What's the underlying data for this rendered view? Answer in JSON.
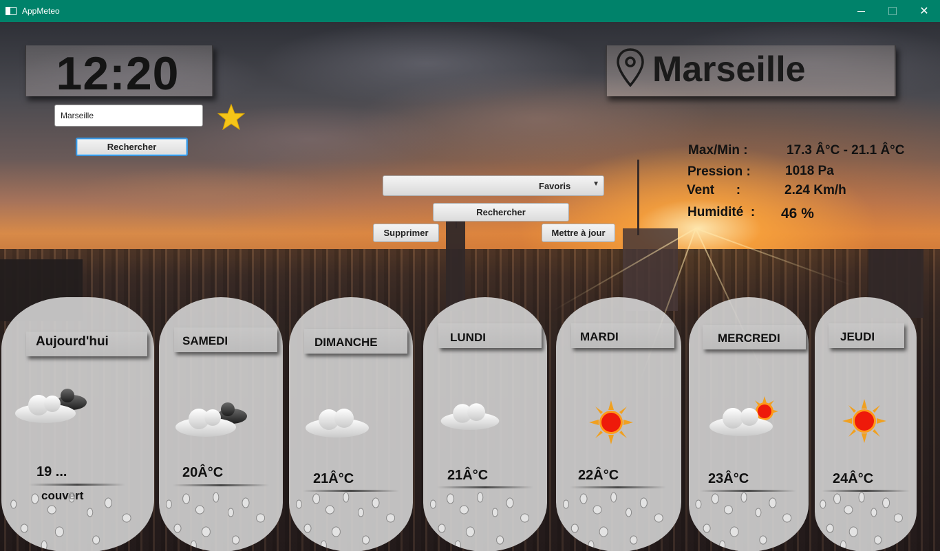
{
  "window": {
    "title": "AppMeteo",
    "controls": {
      "minimize": "—",
      "maximize": "",
      "close": "✕"
    }
  },
  "clock": {
    "time": "12:20"
  },
  "search": {
    "value": "Marseille",
    "button": "Rechercher"
  },
  "favorites": {
    "star_icon": "star-icon",
    "star_color": "#f5c518",
    "dropdown_label": "Favoris",
    "search_button": "Rechercher",
    "delete_button": "Supprimer",
    "update_button": "Mettre à jour"
  },
  "city": {
    "name": "Marseille",
    "icon": "location-pin-icon"
  },
  "details": [
    {
      "label": "Max/Min :",
      "value": "17.3 Â°C - 21.1 Â°C"
    },
    {
      "label": "Pression :",
      "value": "1018 Pa"
    },
    {
      "label": "Vent      :",
      "value": "2.24 Km/h"
    },
    {
      "label": "Humidité  :",
      "value": "46 %"
    }
  ],
  "forecast": [
    {
      "day": "Aujourd'hui",
      "temp": "19 ...",
      "desc": "couvert",
      "icon": "cloudy-icon"
    },
    {
      "day": "SAMEDI",
      "temp": "20Â°C",
      "desc": "",
      "icon": "cloudy-icon"
    },
    {
      "day": "DIMANCHE",
      "temp": "21Â°C",
      "desc": "",
      "icon": "cloud-icon"
    },
    {
      "day": "LUNDI",
      "temp": "21Â°C",
      "desc": "",
      "icon": "cloud-icon"
    },
    {
      "day": "MARDI",
      "temp": "22Â°C",
      "desc": "",
      "icon": "sun-icon"
    },
    {
      "day": "MERCREDI",
      "temp": "23Â°C",
      "desc": "",
      "icon": "partly-sunny-icon"
    },
    {
      "day": "JEUDI",
      "temp": "24Â°C",
      "desc": "",
      "icon": "sun-icon"
    }
  ]
}
